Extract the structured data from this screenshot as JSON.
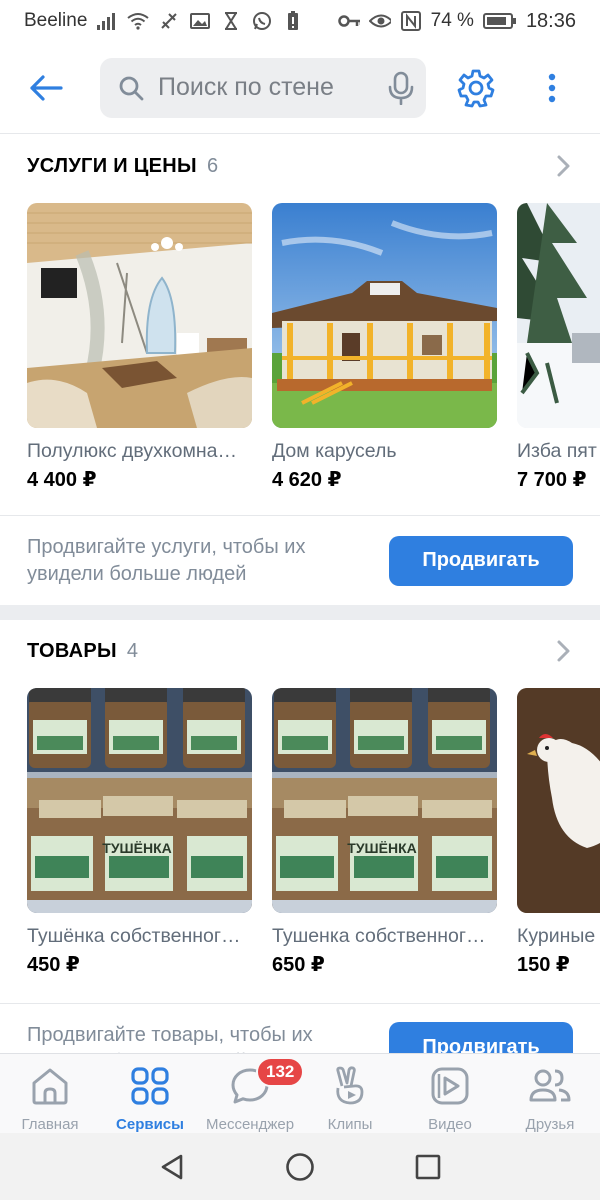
{
  "status_bar": {
    "carrier": "Beeline",
    "battery_text": "74 %",
    "time": "18:36",
    "icons": [
      "signal-icon",
      "wifi-icon",
      "no-data-icon",
      "gallery-icon",
      "hourglass-icon",
      "whatsapp-icon",
      "battery-alert-icon",
      "key-icon",
      "eye-icon",
      "nfc-icon",
      "battery-icon"
    ]
  },
  "header": {
    "search_placeholder": "Поиск по стене",
    "accent_color": "#2f7fe0"
  },
  "services": {
    "title": "УСЛУГИ И ЦЕНЫ",
    "count": "6",
    "items": [
      {
        "name": "Полулюкс двухкомна…",
        "price": "4 400 ₽"
      },
      {
        "name": "Дом карусель",
        "price": "4 620 ₽"
      },
      {
        "name": "Изба пят",
        "price": "7 700 ₽"
      }
    ],
    "promo_text": "Продвигайте услуги, чтобы их увидели больше людей",
    "promo_button": "Продвигать"
  },
  "goods": {
    "title": "ТОВАРЫ",
    "count": "4",
    "items": [
      {
        "name": "Тушёнка собственног…",
        "price": "450 ₽"
      },
      {
        "name": "Тушенка собственног…",
        "price": "650 ₽"
      },
      {
        "name": "Куриные",
        "price": "150 ₽"
      }
    ],
    "jar_label": "ТУШЁНКА",
    "promo_text": "Продвигайте товары, чтобы их увидели больше людей",
    "promo_button": "Продвигать"
  },
  "tabs": [
    {
      "label": "Главная",
      "icon": "home-icon"
    },
    {
      "label": "Сервисы",
      "icon": "services-icon",
      "active": true
    },
    {
      "label": "Мессенджер",
      "icon": "messenger-icon",
      "badge": "132"
    },
    {
      "label": "Клипы",
      "icon": "clips-icon"
    },
    {
      "label": "Видео",
      "icon": "video-icon"
    },
    {
      "label": "Друзья",
      "icon": "friends-icon"
    }
  ]
}
